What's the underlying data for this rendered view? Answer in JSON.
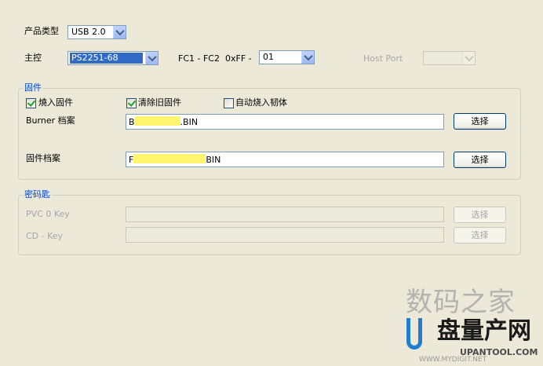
{
  "product_type": {
    "label": "产品类型",
    "value": "USB 2.0"
  },
  "controller": {
    "label": "主控",
    "value": "PS2251-68"
  },
  "fc": {
    "label": "FC1 - FC2",
    "prefix": "0xFF -",
    "value": "01"
  },
  "host_port": {
    "label": "Host Port",
    "value": ""
  },
  "firmware_group": {
    "title": "固件",
    "burn_firmware": {
      "label": "燒入固件",
      "checked": true
    },
    "clear_old_firmware": {
      "label": "清除旧固件",
      "checked": true
    },
    "auto_burn": {
      "label": "自动烧入韧体",
      "checked": false
    },
    "burner_file": {
      "label": "Burner 档案",
      "value_start": "B",
      "value_end": ".BIN",
      "button": "选择"
    },
    "firmware_file": {
      "label": "固件档案",
      "value_start": "F",
      "value_end": "BIN",
      "button": "选择"
    }
  },
  "key_group": {
    "title": "密码匙",
    "pvc_key": {
      "label": "PVC 0 Key",
      "value": "",
      "button": "选择"
    },
    "cd_key": {
      "label": "CD - Key",
      "value": "",
      "button": "选择"
    }
  },
  "watermark": {
    "line1": "数码之家",
    "line2": "盘量产网",
    "line3": "UPANTOOL.COM",
    "line4": "WWW.MYDIGIT.NET"
  }
}
